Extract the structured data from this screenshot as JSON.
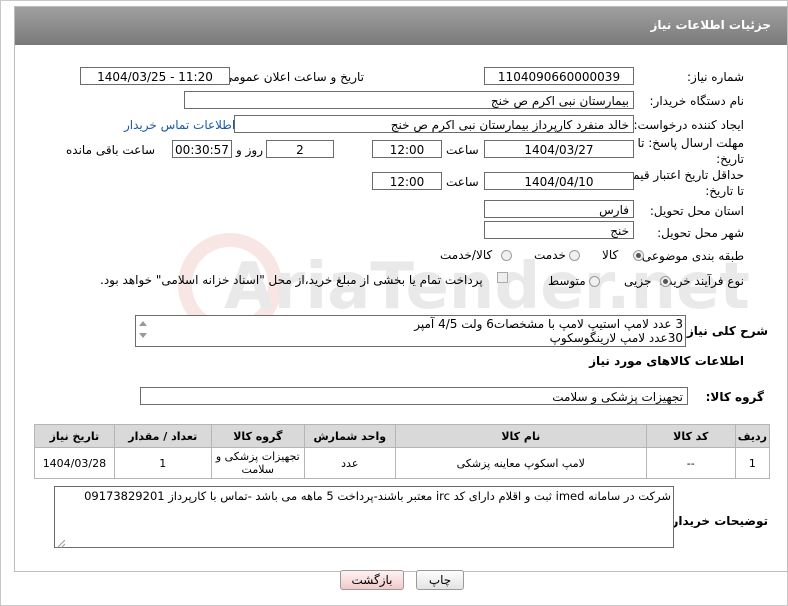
{
  "header": {
    "title": "جزئیات اطلاعات نیاز"
  },
  "fields": {
    "need_number_label": "شماره نیاز:",
    "need_number": "1104090660000039",
    "announce_label": "تاریخ و ساعت اعلان عمومی:",
    "announce_value": "1404/03/25 - 11:20",
    "buyer_org_label": "نام دستگاه خریدار:",
    "buyer_org": "بیمارستان نبی اکرم  ص  خنج",
    "requester_label": "ایجاد کننده درخواست:",
    "requester": "خالد منفرد کارپرداز بیمارستان نبی اکرم  ص  خنج",
    "contact_link": "اطلاعات تماس خریدار",
    "deadline_label_1": "مهلت ارسال پاسخ: تا",
    "deadline_label_2": "تاریخ:",
    "deadline_date": "1404/03/27",
    "hour_label": "ساعت",
    "deadline_time": "12:00",
    "days": "2",
    "days_label": "روز و",
    "remaining_time": "00:30:57",
    "remaining_label": "ساعت باقی مانده",
    "min_validity_label_1": "حداقل تاریخ اعتبار قیمت:",
    "min_validity_label_2": "تا تاریخ:",
    "validity_date": "1404/04/10",
    "validity_time": "12:00",
    "province_label": "استان محل تحویل:",
    "province": "فارس",
    "city_label": "شهر محل تحویل:",
    "city": "خنج",
    "category_label": "طبقه بندی موضوعی:",
    "category_options": [
      "کالا",
      "خدمت",
      "کالا/خدمت"
    ],
    "process_label": "نوع فرآیند خرید :",
    "process_options": [
      "جزیی",
      "متوسط"
    ],
    "payment_note": "پرداخت تمام یا بخشی از مبلغ خرید،از محل \"اسناد خزانه اسلامی\" خواهد بود."
  },
  "description": {
    "label": "شرح کلی نیاز:",
    "line1": "3 عدد لامپ استیپ لامپ با مشخصات6 ولت 4/5 آمپر",
    "line2": "30عدد لامپ لارینگوسکوپ"
  },
  "goods": {
    "section_title": "اطلاعات کالاهای مورد نیاز",
    "group_label": "گروه کالا:",
    "group_value": "تجهیزات پزشکی و سلامت",
    "columns": [
      "ردیف",
      "کد کالا",
      "نام کالا",
      "واحد شمارش",
      "گروه کالا",
      "تعداد / مقدار",
      "تاریخ نیاز"
    ],
    "rows": [
      {
        "row": "1",
        "code": "--",
        "name": "لامپ اسکوپ معاینه پزشکی",
        "unit": "عدد",
        "group": "تجهیزات پزشکی و سلامت",
        "qty": "1",
        "date": "1404/03/28"
      }
    ]
  },
  "buyer_notes": {
    "label": "توضیحات خریدار:",
    "text": "شرکت در سامانه imed ثبت و اقلام دارای کد irc معتبر باشند-پرداخت 5 ماهه می باشد -تماس با کارپرداز 09173829201"
  },
  "buttons": {
    "print": "چاپ",
    "back": "بازگشت"
  },
  "watermark": "AriaTender.net"
}
